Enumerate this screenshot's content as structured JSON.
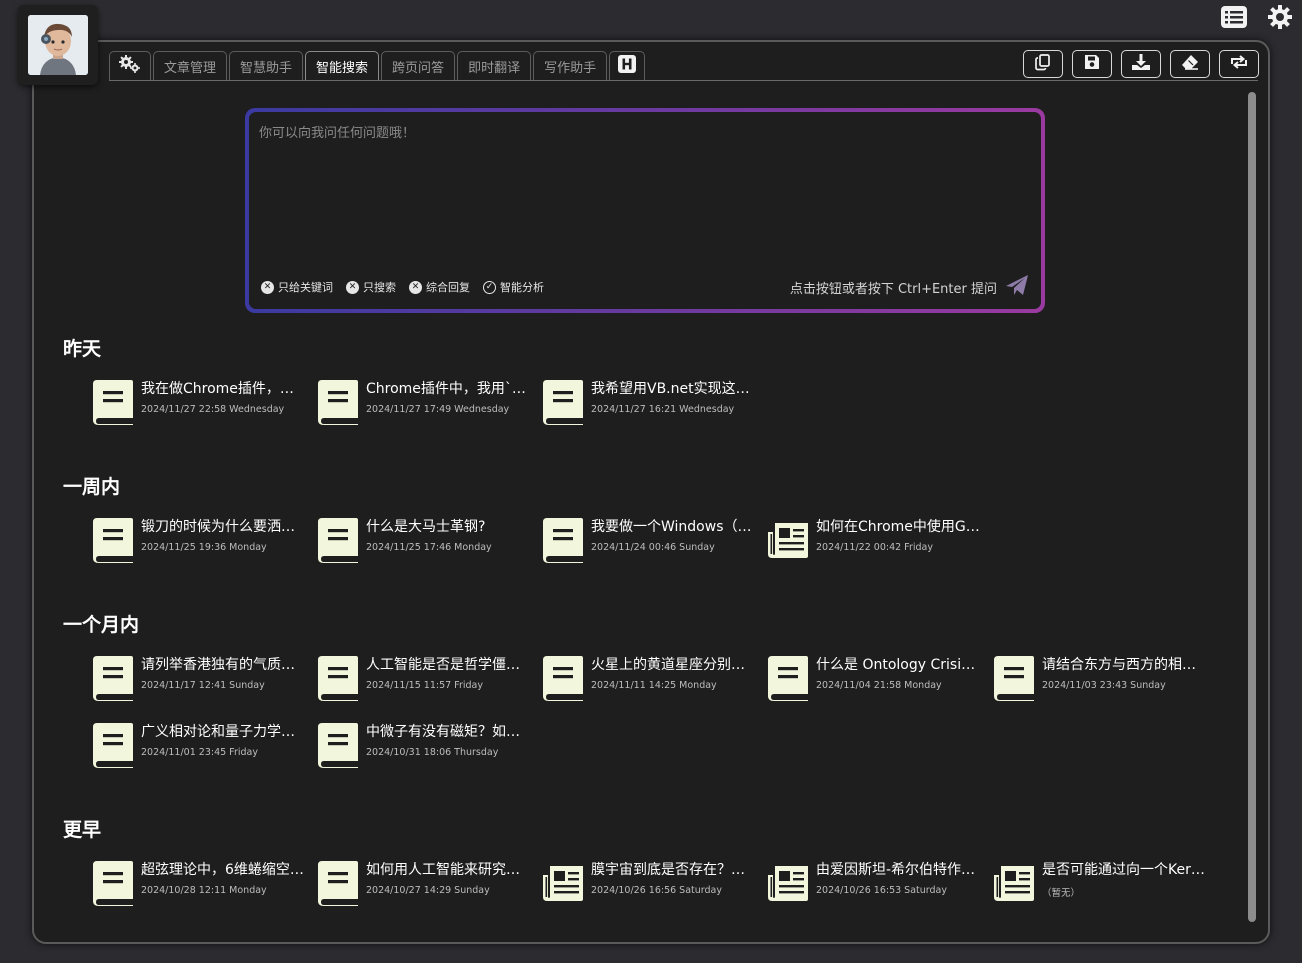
{
  "top_icons": [
    "list-icon",
    "settings-gear-icon"
  ],
  "tabs": [
    {
      "label": "",
      "icon": "gears-icon",
      "active": false
    },
    {
      "label": "文章管理",
      "active": false
    },
    {
      "label": "智慧助手",
      "active": false
    },
    {
      "label": "智能搜索",
      "active": true
    },
    {
      "label": "跨页问答",
      "active": false
    },
    {
      "label": "即时翻译",
      "active": false
    },
    {
      "label": "写作助手",
      "active": false
    },
    {
      "label": "",
      "icon": "h-square-icon",
      "active": false
    }
  ],
  "toolbar": [
    "copy-icon",
    "save-icon",
    "download-icon",
    "eraser-icon",
    "refresh-icon"
  ],
  "question": {
    "placeholder": "你可以向我问任何问题哦！",
    "options": [
      {
        "label": "只给关键词",
        "state": "x"
      },
      {
        "label": "只搜索",
        "state": "x"
      },
      {
        "label": "综合回复",
        "state": "x"
      },
      {
        "label": "智能分析",
        "state": "check"
      }
    ],
    "hint": "点击按钮或者按下 Ctrl+Enter 提问"
  },
  "sections": [
    {
      "title": "昨天",
      "items": [
        {
          "title": "我在做Chrome插件，其…",
          "date": "2024/11/27 22:58 Wednesday",
          "icon": "book"
        },
        {
          "title": "Chrome插件中，我用`c…",
          "date": "2024/11/27 17:49 Wednesday",
          "icon": "book"
        },
        {
          "title": "我希望用VB.net实现这…",
          "date": "2024/11/27 16:21 Wednesday",
          "icon": "book"
        }
      ]
    },
    {
      "title": "一周内",
      "items": [
        {
          "title": "锻刀的时候为什么要洒…",
          "date": "2024/11/25 19:36 Monday",
          "icon": "book"
        },
        {
          "title": "什么是大马士革钢?",
          "date": "2024/11/25 17:46 Monday",
          "icon": "book"
        },
        {
          "title": "我要做一个Windows（…",
          "date": "2024/11/24 00:46 Sunday",
          "icon": "book"
        },
        {
          "title": "如何在Chrome中使用G…",
          "date": "2024/11/22 00:42 Friday",
          "icon": "news"
        }
      ]
    },
    {
      "title": "一个月内",
      "items": [
        {
          "title": "请列举香港独有的气质…",
          "date": "2024/11/17 12:41 Sunday",
          "icon": "book"
        },
        {
          "title": "人工智能是否是哲学僵…",
          "date": "2024/11/15 11:57 Friday",
          "icon": "book"
        },
        {
          "title": "火星上的黄道星座分别…",
          "date": "2024/11/11 14:25 Monday",
          "icon": "book"
        },
        {
          "title": "什么是 Ontology Crisis…",
          "date": "2024/11/04 21:58 Monday",
          "icon": "book"
        },
        {
          "title": "请结合东方与西方的相…",
          "date": "2024/11/03 23:43 Sunday",
          "icon": "book"
        },
        {
          "title": "广义相对论和量子力学…",
          "date": "2024/11/01 23:45 Friday",
          "icon": "book"
        },
        {
          "title": "中微子有没有磁矩？如…",
          "date": "2024/10/31 18:06 Thursday",
          "icon": "book"
        }
      ]
    },
    {
      "title": "更早",
      "items": [
        {
          "title": "超弦理论中，6维蜷缩空…",
          "date": "2024/10/28 12:11 Monday",
          "icon": "book"
        },
        {
          "title": "如何用人工智能来研究…",
          "date": "2024/10/27 14:29 Sunday",
          "icon": "book"
        },
        {
          "title": "膜宇宙到底是否存在？…",
          "date": "2024/10/26 16:56 Saturday",
          "icon": "news"
        },
        {
          "title": "由爱因斯坦-希尔伯特作…",
          "date": "2024/10/26 16:53 Saturday",
          "icon": "news"
        },
        {
          "title": "是否可能通过向一个Ker…",
          "date": "（暂无）",
          "icon": "news"
        }
      ]
    }
  ],
  "colors": {
    "background": "#2c2c30",
    "panel": "#1e1e1e",
    "icon_fill": "#f2f6dc",
    "gradient_start": "#3a3aa0",
    "gradient_end": "#9a3aa0"
  }
}
